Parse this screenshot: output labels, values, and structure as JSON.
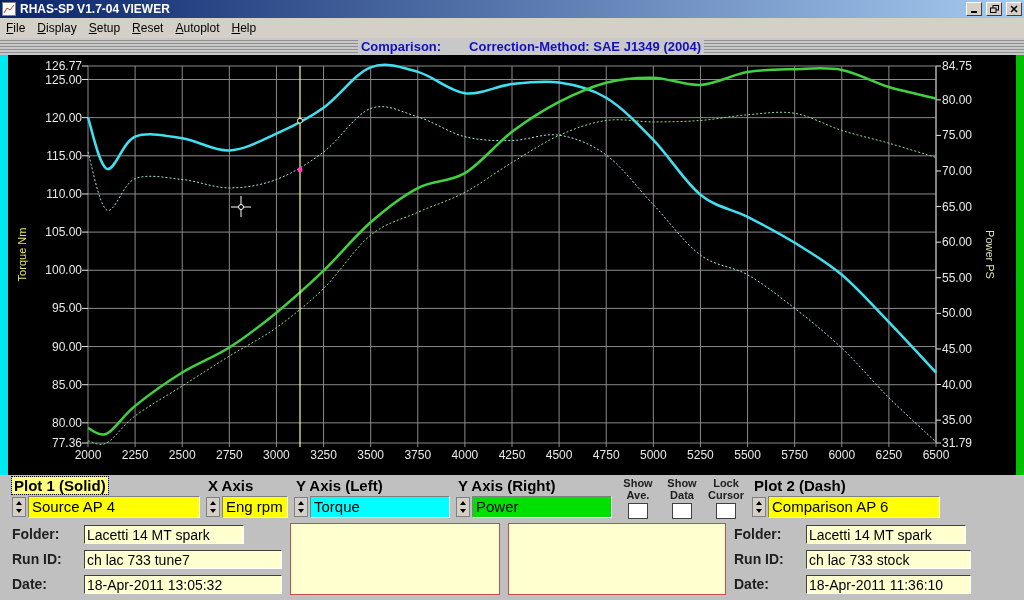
{
  "window": {
    "title": "RHAS-SP V1.7-04  VIEWER"
  },
  "menu": [
    "File",
    "Display",
    "Setup",
    "Reset",
    "Autoplot",
    "Help"
  ],
  "header": {
    "label": "Comparison:",
    "correction": "Correction-Method: SAE J1349 (2004)"
  },
  "chart": {
    "chart_data": {
      "type": "line",
      "x": [
        2000,
        2100,
        2250,
        2500,
        2750,
        3000,
        3250,
        3500,
        3750,
        4000,
        4250,
        4500,
        4750,
        5000,
        5250,
        5500,
        5750,
        6000,
        6250,
        6500
      ],
      "xlim": [
        2000,
        6500
      ],
      "xticks": [
        2000,
        2250,
        2500,
        2750,
        3000,
        3250,
        3500,
        3750,
        4000,
        4250,
        4500,
        4750,
        5000,
        5250,
        5500,
        5750,
        6000,
        6250,
        6500
      ],
      "ylabel": "Torque Nm",
      "ylim": [
        77.36,
        126.77
      ],
      "yticks": [
        {
          "value": 77.36,
          "label": "77.36"
        },
        {
          "value": 80,
          "label": "80.00"
        },
        {
          "value": 85,
          "label": "85.00"
        },
        {
          "value": 90,
          "label": "90.00"
        },
        {
          "value": 95,
          "label": "95.00"
        },
        {
          "value": 100,
          "label": "100.00"
        },
        {
          "value": 105,
          "label": "105.00"
        },
        {
          "value": 110,
          "label": "110.00"
        },
        {
          "value": 115,
          "label": "115.00"
        },
        {
          "value": 120,
          "label": "120.00"
        },
        {
          "value": 125,
          "label": "125.00"
        },
        {
          "value": 126.77,
          "label": "126.77"
        }
      ],
      "y2label": "Power PS",
      "y2lim": [
        31.79,
        84.75
      ],
      "y2ticks": [
        {
          "value": 31.79,
          "label": "31.79"
        },
        {
          "value": 35,
          "label": "35.00"
        },
        {
          "value": 40,
          "label": "40.00"
        },
        {
          "value": 45,
          "label": "45.00"
        },
        {
          "value": 50,
          "label": "50.00"
        },
        {
          "value": 55,
          "label": "55.00"
        },
        {
          "value": 60,
          "label": "60.00"
        },
        {
          "value": 65,
          "label": "65.00"
        },
        {
          "value": 70,
          "label": "70.00"
        },
        {
          "value": 75,
          "label": "75.00"
        },
        {
          "value": 80,
          "label": "80.00"
        },
        {
          "value": 84.75,
          "label": "84.75"
        }
      ],
      "series": [
        {
          "color": "#40e0f0",
          "values": [
            120.0,
            113.3,
            117.5,
            117.3,
            115.7,
            117.9,
            121.3,
            126.6,
            126.0,
            123.2,
            124.4,
            124.6,
            122.6,
            117.1,
            109.9,
            107.0,
            103.6,
            99.4,
            93.2,
            86.6
          ]
        },
        {
          "color": "#a0e8e8",
          "line_style": "dashed",
          "values": [
            115.5,
            107.9,
            112.0,
            111.9,
            110.8,
            111.9,
            115.5,
            121.2,
            120.1,
            117.5,
            117.0,
            117.7,
            115.1,
            108.6,
            102.0,
            99.4,
            95.0,
            89.8,
            83.3,
            77.5
          ]
        },
        {
          "color": "#40d040",
          "axis": "y2",
          "values": [
            33.9,
            33.1,
            37.0,
            41.7,
            45.2,
            50.1,
            56.0,
            62.8,
            67.6,
            69.7,
            75.5,
            79.7,
            82.4,
            83.1,
            82.1,
            83.9,
            84.3,
            84.2,
            81.8,
            80.2
          ]
        },
        {
          "color": "#90e090",
          "axis": "y2",
          "line_style": "dashed",
          "values": [
            32.1,
            31.8,
            35.6,
            39.8,
            44.0,
            48.0,
            53.5,
            61.0,
            64.2,
            67.0,
            71.2,
            75.0,
            77.1,
            76.9,
            77.1,
            77.9,
            78.1,
            75.7,
            73.9,
            71.9
          ]
        }
      ],
      "grid": true,
      "ref_lines": [
        {
          "axis": "x",
          "value": 3125,
          "color": "#ffff90"
        }
      ]
    }
  },
  "selectors": [
    {
      "heading": "Plot 1 (Solid)",
      "focused": true,
      "value": "Source AP 4",
      "color": "#ffff00"
    },
    {
      "heading": "X Axis",
      "focused": false,
      "value": "Eng rpm",
      "color": "#ffff00"
    },
    {
      "heading": "Y Axis (Left)",
      "focused": false,
      "value": "Torque",
      "color": "#00ffff"
    },
    {
      "heading": "Y Axis (Right)",
      "focused": false,
      "value": "Power",
      "color": "#00e000"
    }
  ],
  "checkboxes": [
    {
      "label": "Show Ave.",
      "checked": false
    },
    {
      "label": "Show Data",
      "checked": false
    },
    {
      "label": "Lock Cursor",
      "checked": false
    }
  ],
  "plot2": {
    "heading": "Plot 2 (Dash)",
    "focused": false,
    "value": "Comparison AP 6",
    "color": "#ffff00"
  },
  "info_1": [
    {
      "label": "Folder:",
      "value": "Lacetti 14 MT spark"
    },
    {
      "label": "Run ID:",
      "value": "ch lac 733 tune7"
    },
    {
      "label": "Date:",
      "value": "18-Apr-2011  13:05:32"
    }
  ],
  "info_2": [
    {
      "label": "Folder:",
      "value": "Lacetti 14 MT spark"
    },
    {
      "label": "Run ID:",
      "value": "ch lac 733 stock"
    },
    {
      "label": "Date:",
      "value": "18-Apr-2011  11:36:10"
    }
  ]
}
